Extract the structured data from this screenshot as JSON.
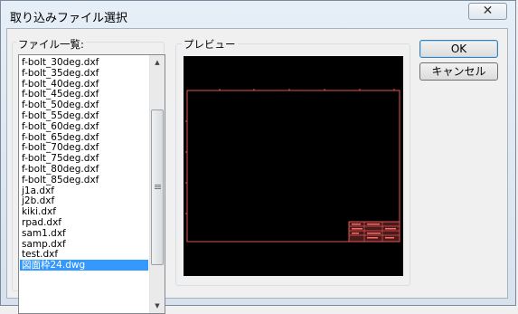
{
  "dialog": {
    "title": "取り込みファイル選択",
    "close_glyph": "✕"
  },
  "file_list": {
    "label": "ファイル一覧:",
    "items": [
      "f-bolt_30deg.dxf",
      "f-bolt_35deg.dxf",
      "f-bolt_40deg.dxf",
      "f-bolt_45deg.dxf",
      "f-bolt_50deg.dxf",
      "f-bolt_55deg.dxf",
      "f-bolt_60deg.dxf",
      "f-bolt_65deg.dxf",
      "f-bolt_70deg.dxf",
      "f-bolt_75deg.dxf",
      "f-bolt_80deg.dxf",
      "f-bolt_85deg.dxf",
      "j1a.dxf",
      "j2b.dxf",
      "kiki.dxf",
      "rpad.dxf",
      "sam1.dxf",
      "samp.dxf",
      "test.dxf",
      "図面枠24.dwg"
    ],
    "selected_index": 19,
    "scroll_up_glyph": "▲",
    "scroll_down_glyph": "▼"
  },
  "preview": {
    "label": "プレビュー",
    "line_color": "#e05555",
    "background": "#000000"
  },
  "buttons": {
    "ok": "OK",
    "cancel": "キャンセル"
  }
}
